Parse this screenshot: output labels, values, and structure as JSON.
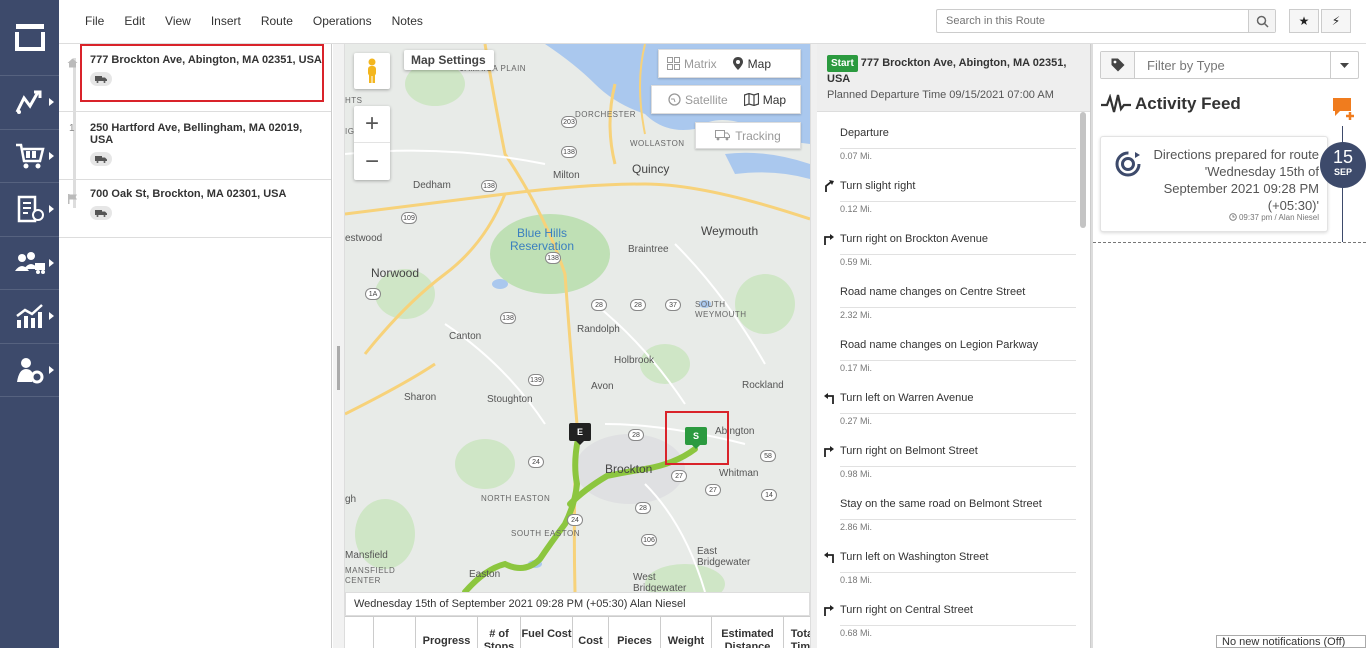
{
  "menu": [
    "File",
    "Edit",
    "View",
    "Insert",
    "Route",
    "Operations",
    "Notes"
  ],
  "search": {
    "placeholder": "Search in this Route"
  },
  "toolbar": {
    "favorite_label": "★",
    "quick_label": "⚡"
  },
  "stops": [
    {
      "number": "",
      "address": "777 Brockton Ave, Abington, MA 02351, USA"
    },
    {
      "number": "1",
      "address": "250 Hartford Ave, Bellingham, MA 02019, USA"
    },
    {
      "number": "",
      "address": "700 Oak St, Brockton, MA 02301, USA"
    }
  ],
  "map": {
    "settings_label": "Map Settings",
    "matrix_label": "Matrix",
    "map_label": "Map",
    "satellite_label": "Satellite",
    "map2_label": "Map",
    "tracking_label": "Tracking",
    "zoom_in": "+",
    "zoom_out": "−",
    "marker_end": "E",
    "marker_start": "S",
    "labels": {
      "jamaica_plain": "JAMAICA PLAIN",
      "hts": "HTS",
      "ights": "IGHTS",
      "dorchester": "DORCHESTER",
      "wollaston": "WOLLASTON",
      "quincy": "Quincy",
      "milton": "Milton",
      "dedham": "Dedham",
      "westwood": "estwood",
      "blue_hills": "Blue Hills\nReservation",
      "braintree": "Braintree",
      "weymouth": "Weymouth",
      "norwood": "Norwood",
      "south_weymouth": "SOUTH\nWEYMOUTH",
      "canton": "Canton",
      "randolph": "Randolph",
      "holbrook": "Holbrook",
      "stoughton": "Stoughton",
      "sharon": "Sharon",
      "avon": "Avon",
      "rockland": "Rockland",
      "abington": "Abington",
      "brockton": "Brockton",
      "whitman": "Whitman",
      "north_easton": "NORTH EASTON",
      "south_easton": "SOUTH EASTON",
      "easton": "Easton",
      "east_bridgewater": "East\nBridgewater",
      "west_bridgewater": "West\nBridgewater",
      "mansfield": "Mansfield",
      "mansfield_center": "MANSFIELD\nCENTER",
      "gh": "gh"
    }
  },
  "summary": "Wednesday 15th of September 2021 09:28 PM (+05:30) Alan Niesel",
  "table_columns": [
    "",
    "",
    "Progress",
    "# of Stops",
    "Fuel Cost",
    "Cost",
    "Pieces",
    "Weight",
    "Estimated Distance",
    "Total Time"
  ],
  "directions": {
    "start_badge": "Start",
    "start_address": "777 Brockton Ave, Abington, MA 02351, USA",
    "planned": "Planned Departure Time 09/15/2021 07:00 AM",
    "steps": [
      {
        "icon": "none",
        "text": "Departure",
        "dist": "0.07 Mi."
      },
      {
        "icon": "slight-right",
        "text": "Turn slight right",
        "dist": "0.12 Mi."
      },
      {
        "icon": "right",
        "text": "Turn right on Brockton Avenue",
        "dist": "0.59 Mi."
      },
      {
        "icon": "none",
        "text": "Road name changes on Centre Street",
        "dist": "2.32 Mi."
      },
      {
        "icon": "none",
        "text": "Road name changes on Legion Parkway",
        "dist": "0.17 Mi."
      },
      {
        "icon": "left",
        "text": "Turn left on Warren Avenue",
        "dist": "0.27 Mi."
      },
      {
        "icon": "right",
        "text": "Turn right on Belmont Street",
        "dist": "0.98 Mi."
      },
      {
        "icon": "none",
        "text": "Stay on the same road on Belmont Street",
        "dist": "2.86 Mi."
      },
      {
        "icon": "left",
        "text": "Turn left on Washington Street",
        "dist": "0.18 Mi."
      },
      {
        "icon": "right",
        "text": "Turn right on Central Street",
        "dist": "0.68 Mi."
      }
    ]
  },
  "activity": {
    "filter_placeholder": "Filter by Type",
    "title": "Activity Feed",
    "card_message": "Directions prepared for route 'Wednesday 15th of September 2021 09:28 PM (+05:30)'",
    "card_meta": "09:37 pm / Alan Niesel",
    "date_day": "15",
    "date_month": "SEP"
  },
  "notification": "No new notifications (Off)",
  "colors": {
    "nav": "#3d4a6b",
    "accent_green": "#2b9a3f",
    "route": "#8cc63f",
    "highlight_red": "#d9232a",
    "feed_orange": "#f07c1e"
  }
}
